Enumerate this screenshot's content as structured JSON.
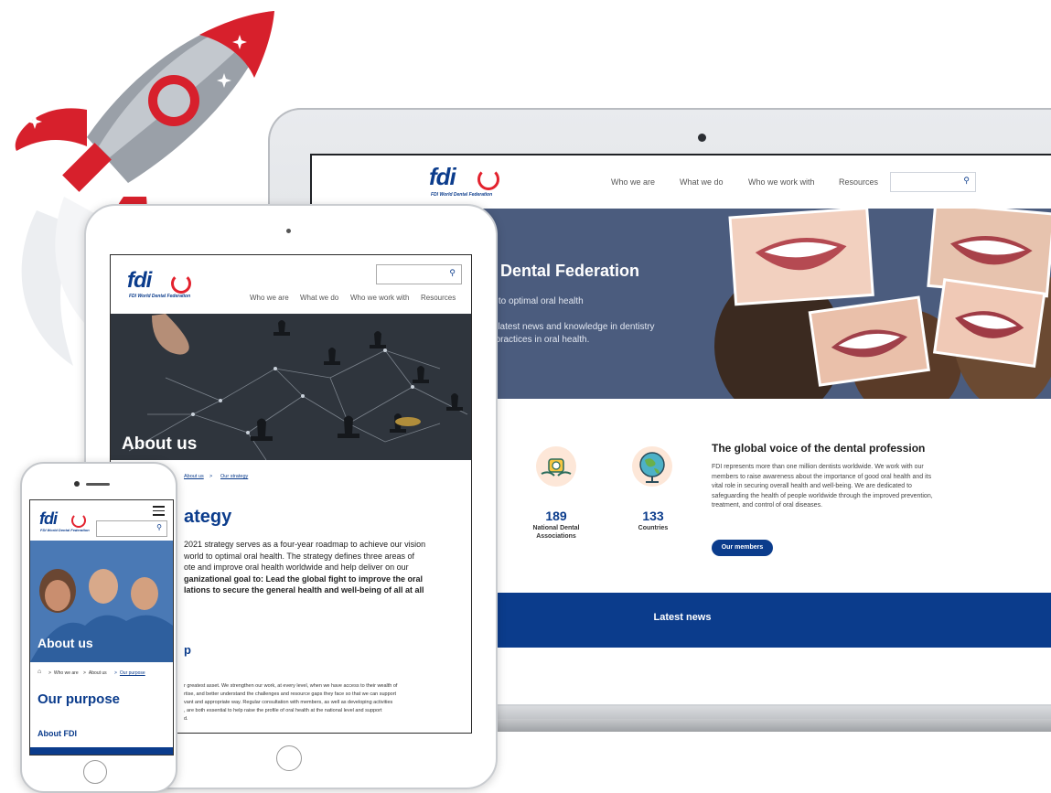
{
  "brand": {
    "logo_text": "fdi",
    "tagline": "FDI World Dental Federation",
    "primary_color": "#0b3c8c",
    "accent_color": "#e3222e"
  },
  "desktop": {
    "nav": [
      "Who we are",
      "What we do",
      "Who we work with",
      "Resources"
    ],
    "search": {
      "icon": "search-icon"
    },
    "hero": {
      "title": "d Dental Federation",
      "subtitle": "rld to optimal oral health",
      "desc_line1": "e latest news and knowledge in dentistry",
      "desc_line2": "t practices in oral health."
    },
    "stats": [
      {
        "value": "189",
        "label_line1": "National Dental",
        "label_line2": "Associations",
        "icon": "handshake-icon"
      },
      {
        "value": "133",
        "label_line1": "Countries",
        "label_line2": "",
        "icon": "globe-icon"
      }
    ],
    "voice": {
      "title": "The global voice of the dental profession",
      "lines": [
        "FDI represents more than one million dentists worldwide. We work with our",
        "members to raise awareness about the importance of good oral health and its",
        "vital role in securing overall health and well-being. We are dedicated to",
        "safeguarding the health of people worldwide through the improved prevention,",
        "treatment, and control of oral diseases."
      ],
      "button": "Our members"
    },
    "news_title": "Latest news"
  },
  "tablet": {
    "nav": [
      "Who we are",
      "What we do",
      "Who we work with",
      "Resources"
    ],
    "hero_title": "About us",
    "breadcrumb": [
      "About us",
      "Our strategy"
    ],
    "breadcrumb_sep": ">",
    "heading": "ategy",
    "para": [
      "2021 strategy serves as a four-year roadmap to achieve our vision",
      "world to optimal oral health. The strategy defines three areas of",
      "ote and improve oral health worldwide and help deliver on our",
      "ganizational goal to: Lead the global fight to improve the oral",
      "lations to secure the general health and well-being of all at all"
    ],
    "subheading": "p",
    "para2": [
      "r greatest asset. We strengthen our work, at every level, when we have access to their wealth of",
      "rtise, and better understand the challenges and resource gaps they face so that we can support",
      "vant and appropriate way. Regular consultation with members, as well as developing activities",
      ", are both essential to help raise the profile of oral health at the national level and support",
      "d."
    ]
  },
  "phone": {
    "hero_title": "About us",
    "breadcrumb": [
      "Who we are",
      "About us",
      "Our purpose"
    ],
    "heading": "Our purpose",
    "subheading": "About FDI"
  }
}
